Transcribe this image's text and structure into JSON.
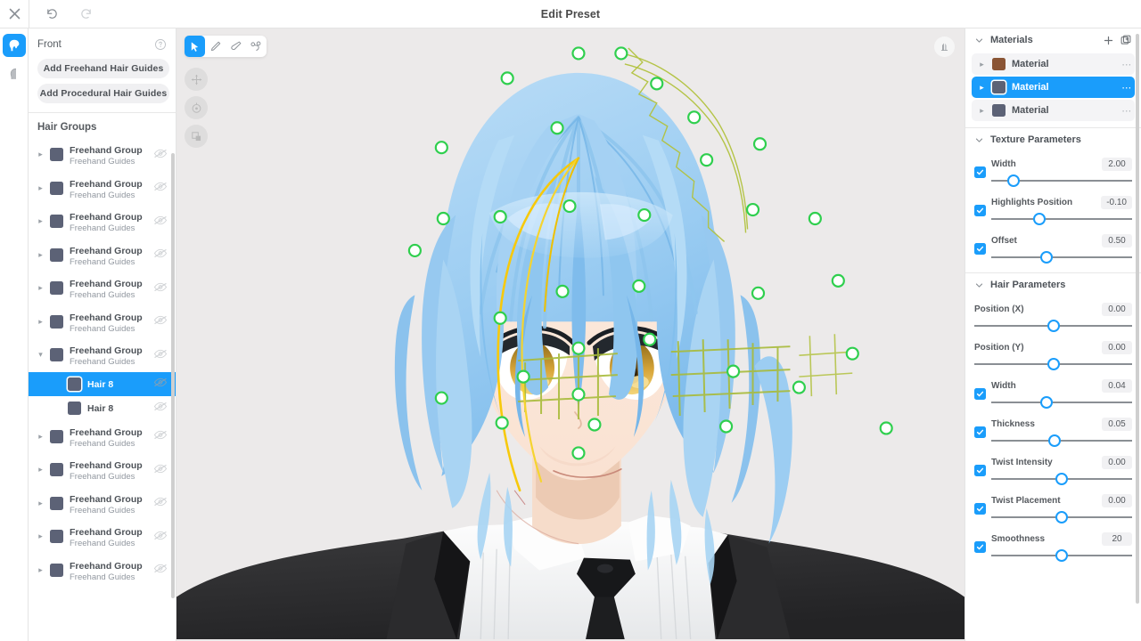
{
  "window": {
    "title": "Edit Preset",
    "close_icon": "close-icon",
    "undo_icon": "undo-icon",
    "redo_icon": "redo-icon"
  },
  "rail": {
    "items": [
      {
        "icon": "hair-head-icon",
        "active": true
      },
      {
        "icon": "head-silhouette-icon",
        "active": false
      }
    ]
  },
  "left_panel": {
    "view_label": "Front",
    "help_icon": "help-circle-icon",
    "buttons": [
      {
        "label": "Add Freehand Hair Guides",
        "name": "add-freehand-hair-guides-button"
      },
      {
        "label": "Add Procedural Hair Guides",
        "name": "add-procedural-hair-guides-button"
      }
    ],
    "groups_title": "Hair Groups",
    "rows": [
      {
        "type": "group",
        "title": "Freehand Group",
        "subtitle": "Freehand Guides",
        "expanded": false,
        "selected": false
      },
      {
        "type": "group",
        "title": "Freehand Group",
        "subtitle": "Freehand Guides",
        "expanded": false,
        "selected": false
      },
      {
        "type": "group",
        "title": "Freehand Group",
        "subtitle": "Freehand Guides",
        "expanded": false,
        "selected": false
      },
      {
        "type": "group",
        "title": "Freehand Group",
        "subtitle": "Freehand Guides",
        "expanded": false,
        "selected": false
      },
      {
        "type": "group",
        "title": "Freehand Group",
        "subtitle": "Freehand Guides",
        "expanded": false,
        "selected": false
      },
      {
        "type": "group",
        "title": "Freehand Group",
        "subtitle": "Freehand Guides",
        "expanded": false,
        "selected": false
      },
      {
        "type": "group",
        "title": "Freehand Group",
        "subtitle": "Freehand Guides",
        "expanded": true,
        "selected": false
      },
      {
        "type": "child",
        "title": "Hair 8",
        "subtitle": "",
        "expanded": false,
        "selected": true
      },
      {
        "type": "child",
        "title": "Hair 8",
        "subtitle": "",
        "expanded": false,
        "selected": false
      },
      {
        "type": "group",
        "title": "Freehand Group",
        "subtitle": "Freehand Guides",
        "expanded": false,
        "selected": false
      },
      {
        "type": "group",
        "title": "Freehand Group",
        "subtitle": "Freehand Guides",
        "expanded": false,
        "selected": false
      },
      {
        "type": "group",
        "title": "Freehand Group",
        "subtitle": "Freehand Guides",
        "expanded": false,
        "selected": false
      },
      {
        "type": "group",
        "title": "Freehand Group",
        "subtitle": "Freehand Guides",
        "expanded": false,
        "selected": false
      },
      {
        "type": "group",
        "title": "Freehand Group",
        "subtitle": "Freehand Guides",
        "expanded": false,
        "selected": false
      }
    ]
  },
  "viewport": {
    "tools": [
      {
        "icon": "select-cursor-icon",
        "active": true
      },
      {
        "icon": "pencil-icon",
        "active": false
      },
      {
        "icon": "eraser-icon",
        "active": false
      },
      {
        "icon": "node-path-icon",
        "active": false
      }
    ],
    "side_buttons": [
      {
        "icon": "move-arrows-icon"
      },
      {
        "icon": "target-circle-icon"
      },
      {
        "icon": "scale-box-icon"
      }
    ],
    "top_right_icon": "lighting-sliders-icon"
  },
  "right_panel": {
    "materials": {
      "title": "Materials",
      "collapse_icon": "chevron-down-icon",
      "add_icon": "plus-icon",
      "duplicate_icon": "duplicate-icon",
      "items": [
        {
          "label": "Material",
          "color": "#8a5535",
          "selected": false
        },
        {
          "label": "Material",
          "color": "#5c6276",
          "selected": true
        },
        {
          "label": "Material",
          "color": "#5c6276",
          "selected": false
        }
      ],
      "more_icon": "more-dots-icon"
    },
    "texture_parameters": {
      "title": "Texture Parameters",
      "collapse_icon": "chevron-down-icon",
      "params": [
        {
          "label": "Width",
          "value": "2.00",
          "checkbox": true,
          "knob_pct": 16
        },
        {
          "label": "Highlights Position",
          "value": "-0.10",
          "checkbox": true,
          "knob_pct": 34
        },
        {
          "label": "Offset",
          "value": "0.50",
          "checkbox": true,
          "knob_pct": 39
        }
      ]
    },
    "hair_parameters": {
      "title": "Hair Parameters",
      "collapse_icon": "chevron-down-icon",
      "params": [
        {
          "label": "Position (X)",
          "value": "0.00",
          "checkbox": false,
          "knob_pct": 50
        },
        {
          "label": "Position (Y)",
          "value": "0.00",
          "checkbox": false,
          "knob_pct": 50
        },
        {
          "label": "Width",
          "value": "0.04",
          "checkbox": true,
          "knob_pct": 39
        },
        {
          "label": "Thickness",
          "value": "0.05",
          "checkbox": true,
          "knob_pct": 45
        },
        {
          "label": "Twist Intensity",
          "value": "0.00",
          "checkbox": true,
          "knob_pct": 50
        },
        {
          "label": "Twist Placement",
          "value": "0.00",
          "checkbox": true,
          "knob_pct": 50
        },
        {
          "label": "Smoothness",
          "value": "20",
          "checkbox": true,
          "knob_pct": 50
        }
      ]
    }
  }
}
